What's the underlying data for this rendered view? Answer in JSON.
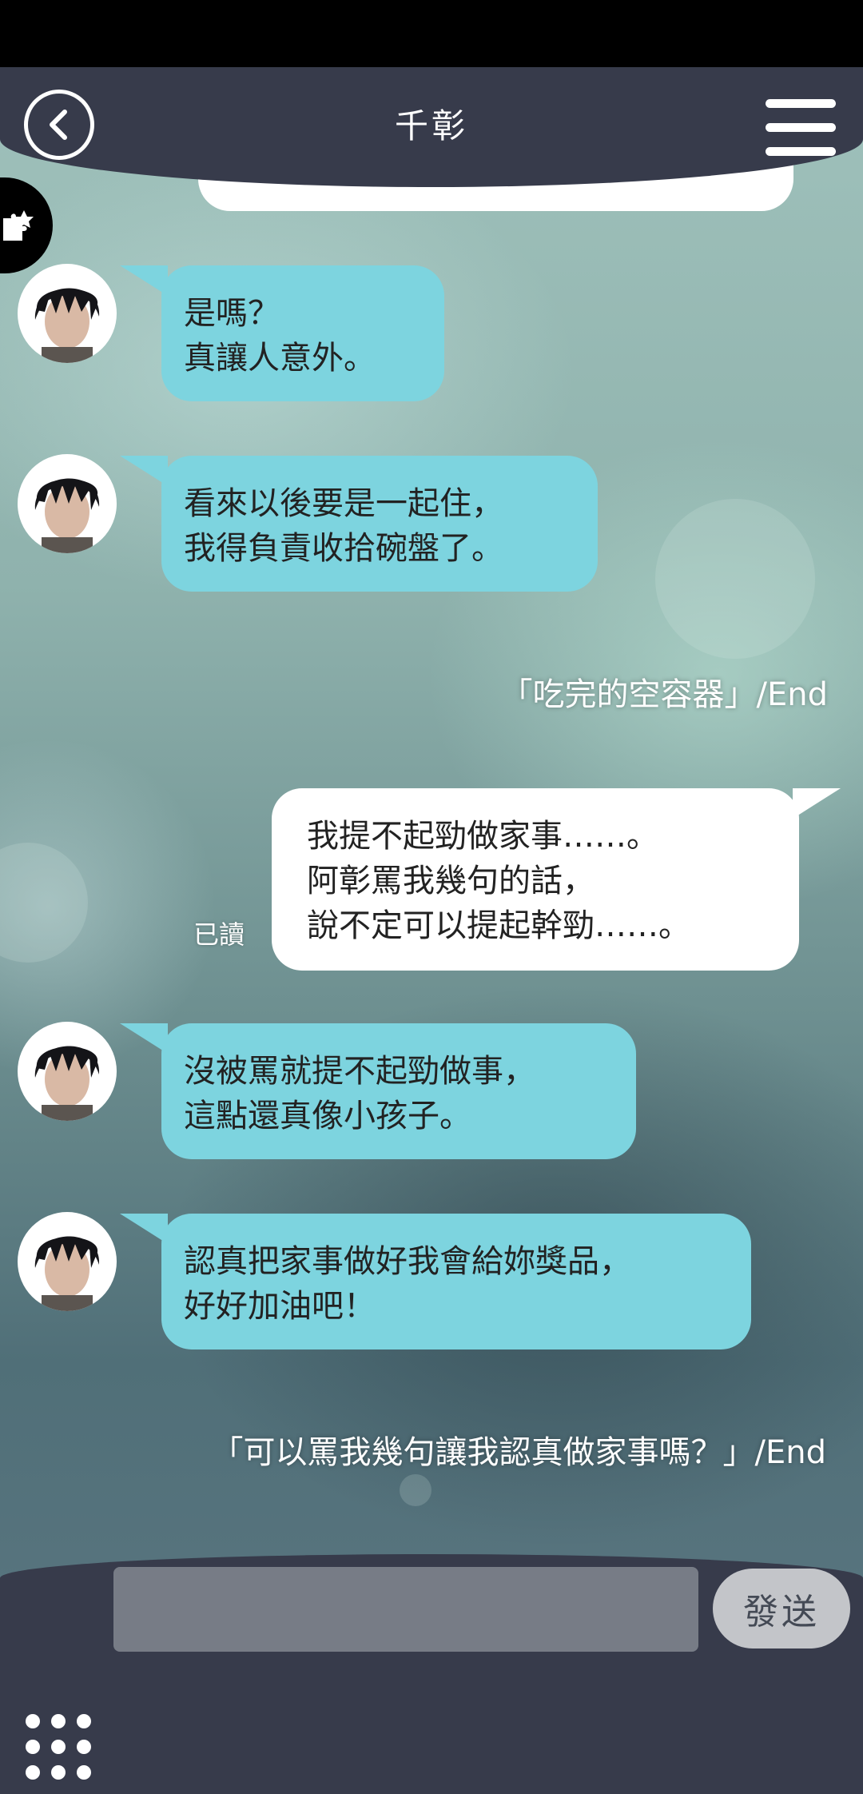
{
  "header": {
    "title": "千彰"
  },
  "messages": [
    {
      "side": "in",
      "lines": [
        "是嗎？",
        "真讓人意外。"
      ]
    },
    {
      "side": "in",
      "lines": [
        "看來以後要是一起住，",
        "我得負責收拾碗盤了。"
      ]
    },
    {
      "side": "event",
      "text": "「吃完的空容器」/End"
    },
    {
      "side": "out",
      "lines": [
        "我提不起勁做家事……。",
        "阿彰罵我幾句的話，",
        "說不定可以提起幹勁……。"
      ],
      "status": "已讀"
    },
    {
      "side": "in",
      "lines": [
        "沒被罵就提不起勁做事，",
        "這點還真像小孩子。"
      ]
    },
    {
      "side": "in",
      "lines": [
        "認真把家事做好我會給妳獎品，",
        "好好加油吧！"
      ]
    },
    {
      "side": "event",
      "text": "「可以罵我幾句讓我認真做家事嗎？」/End"
    }
  ],
  "footer": {
    "input_value": "",
    "send_label": "發送"
  },
  "colors": {
    "header_bg": "#373b4b",
    "incoming_bubble": "#7dd4df",
    "outgoing_bubble": "#ffffff"
  },
  "icons": {
    "back": "chevron-left-circle-icon",
    "menu": "hamburger-menu-icon",
    "side": "puzzle-icon",
    "apps": "grid-dots-icon"
  }
}
